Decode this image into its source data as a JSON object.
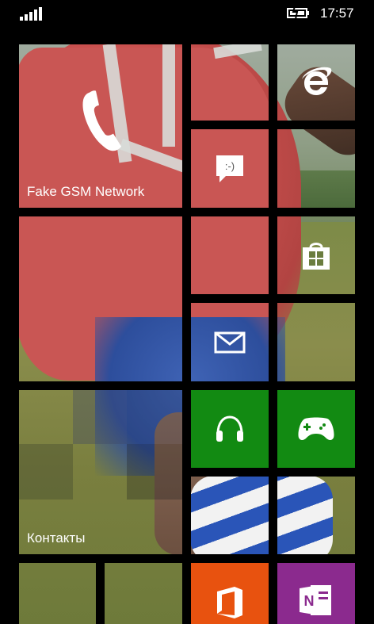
{
  "status_bar": {
    "time": "17:57",
    "signal_icon": "signal-bars-icon",
    "battery_icon": "battery-charging-icon"
  },
  "tiles": {
    "phone": {
      "label": "Fake GSM Network",
      "icon": "phone-icon"
    },
    "ie": {
      "icon": "internet-explorer-icon"
    },
    "messaging": {
      "icon": "messaging-icon"
    },
    "store": {
      "icon": "store-icon"
    },
    "mail": {
      "icon": "mail-icon"
    },
    "music": {
      "icon": "headphones-icon",
      "color": "#128a12"
    },
    "xbox": {
      "icon": "xbox-controller-icon",
      "color": "#128a12"
    },
    "people": {
      "label": "Контакты"
    },
    "office": {
      "icon": "office-icon",
      "color": "#e8520f"
    },
    "onenote": {
      "icon": "onenote-icon",
      "color": "#8b2a8e"
    }
  }
}
